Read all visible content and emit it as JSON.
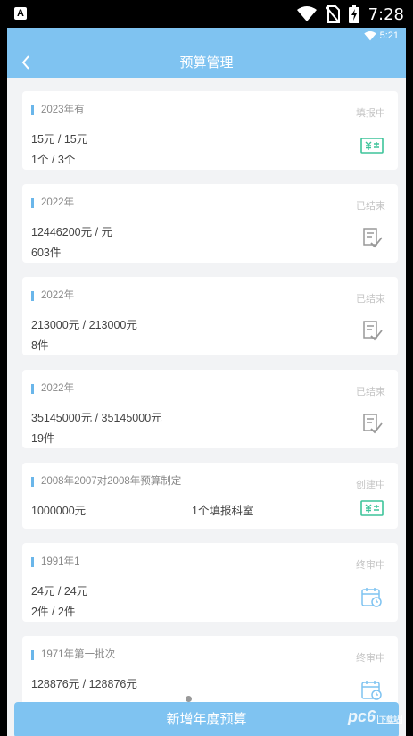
{
  "status_bar": {
    "time": "7:28"
  },
  "inner_status": {
    "time": "5:21"
  },
  "header": {
    "title": "预算管理"
  },
  "cards": [
    {
      "title": "2023年有",
      "status": "填报中",
      "line1": "15元 / 15元",
      "line2": "1个 / 3个",
      "icon": "yuan-money-icon"
    },
    {
      "title": "2022年",
      "status": "已结束",
      "line1": "12446200元 / 元",
      "line2": "603件",
      "icon": "document-check-icon"
    },
    {
      "title": "2022年",
      "status": "已结束",
      "line1": "213000元 / 213000元",
      "line2": "8件",
      "icon": "document-check-icon"
    },
    {
      "title": "2022年",
      "status": "已结束",
      "line1": "35145000元 / 35145000元",
      "line2": "19件",
      "icon": "document-check-icon"
    },
    {
      "title": "2008年2007对2008年预算制定",
      "status": "创建中",
      "line1": "1000000元",
      "dept": "1个填报科室",
      "icon": "yuan-money-icon"
    },
    {
      "title": "1991年1",
      "status": "终审中",
      "line1": "24元 / 24元",
      "line2": "2件 / 2件",
      "icon": "calendar-clock-icon"
    },
    {
      "title": "1971年第一批次",
      "status": "终审中",
      "line1": "128876元 / 128876元",
      "line2": "",
      "icon": "calendar-clock-icon"
    }
  ],
  "bottom_button": {
    "label": "新增年度预算"
  },
  "watermark": {
    "text": "pc6",
    "small": "下载站"
  },
  "colors": {
    "header": "#7fc3f1",
    "accent_bar": "#6ab6ea",
    "money_icon": "#3dc49a",
    "status_text": "#c4c4c4"
  }
}
